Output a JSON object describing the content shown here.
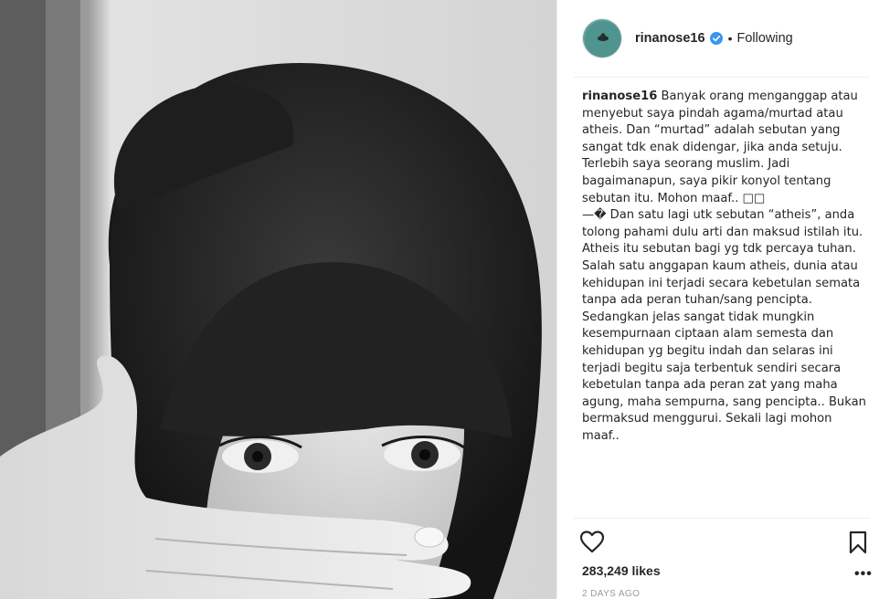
{
  "post": {
    "photo_icon": "photo-black-white-portrait",
    "header": {
      "username": "rinanose16",
      "verified_icon": "verified-badge-icon",
      "separator": "•",
      "follow_status": "Following"
    },
    "caption": {
      "username": "rinanose16",
      "text": " Banyak orang menganggap atau menyebut saya pindah agama/murtad atau atheis. Dan “murtad” adalah sebutan yang sangat tdk enak didengar, jika anda setuju. Terlebih saya seorang muslim. Jadi bagaimanapun, saya pikir konyol tentang sebutan itu. Mohon maaf.. □□\n—� Dan satu lagi utk sebutan “atheis”, anda tolong pahami dulu arti dan maksud istilah itu. Atheis itu sebutan bagi yg tdk percaya tuhan. Salah satu anggapan kaum atheis, dunia atau kehidupan ini terjadi secara kebetulan semata tanpa ada peran tuhan/sang pencipta. Sedangkan jelas sangat tidak mungkin kesempurnaan ciptaan alam semesta dan kehidupan yg begitu indah dan selaras ini terjadi begitu saja terbentuk sendiri secara kebetulan tanpa ada peran zat yang maha agung, maha sempurna, sang pencipta.. Bukan bermaksud menggurui. Sekali lagi mohon maaf.."
    },
    "actions": {
      "like_icon": "heart-icon",
      "save_icon": "bookmark-icon",
      "more_label": "•••"
    },
    "likes": "283,249 likes",
    "date": "2 DAYS AGO"
  },
  "colors": {
    "text": "#262626",
    "muted": "#999999",
    "verified": "#3897f0",
    "divider": "#efefef"
  }
}
